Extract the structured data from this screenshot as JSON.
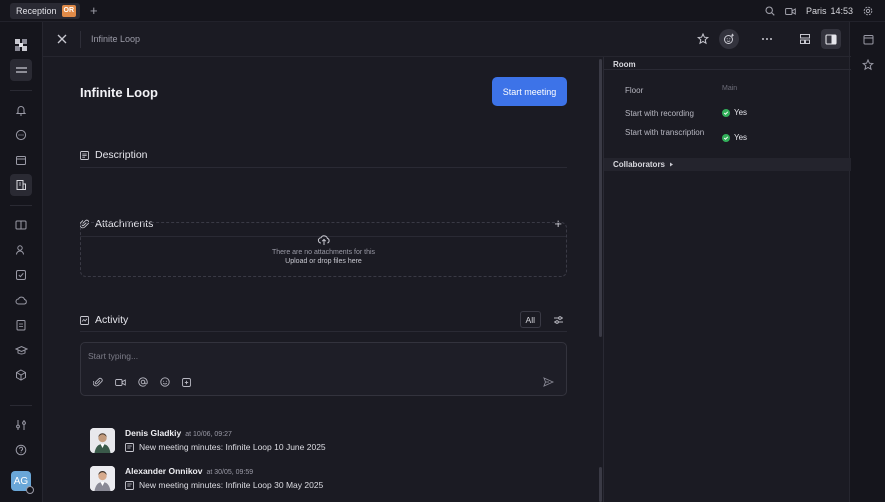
{
  "topbar": {
    "workspace_tab": "Reception",
    "workspace_badge": "OR",
    "city": "Paris",
    "time": "14:53"
  },
  "header": {
    "breadcrumb_title": "Infinite Loop"
  },
  "main": {
    "title": "Infinite Loop",
    "start_meeting_label": "Start meeting",
    "description_label": "Description",
    "attachments_label": "Attachments",
    "dropzone_line1": "There are no attachments for this",
    "dropzone_line2": "Upload or drop files here",
    "activity_label": "Activity",
    "filter_all_label": "All",
    "composer_placeholder": "Start typing...",
    "feed": [
      {
        "author": "Denis Gladkiy",
        "date": "at 10/06, 09:27",
        "text": "New meeting minutes: Infinite Loop 10 June 2025"
      },
      {
        "author": "Alexander Onnikov",
        "date": "at 30/05, 09:59",
        "text": "New meeting minutes: Infinite Loop 30 May 2025"
      }
    ]
  },
  "right_panel": {
    "section_title": "Room",
    "floor_label": "Floor",
    "floor_value": "Main",
    "recording_label": "Start with recording",
    "recording_value": "Yes",
    "transcription_label": "Start with transcription",
    "transcription_value": "Yes",
    "collaborators_label": "Collaborators"
  },
  "sidebar": {
    "avatar_initials": "AG"
  },
  "colors": {
    "accent": "#3d73e8",
    "check_green": "#32b05a",
    "badge_orange": "#e08a48"
  }
}
